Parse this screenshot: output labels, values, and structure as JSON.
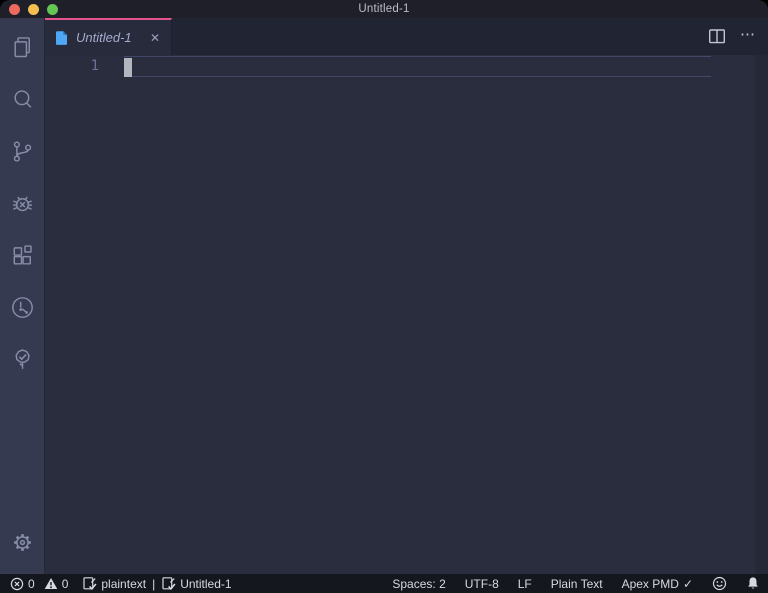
{
  "window": {
    "title": "Untitled-1"
  },
  "traffic_lights": {
    "colors": {
      "close": "#ed6a5e",
      "minimize": "#f5bf4f",
      "zoom": "#62c554"
    }
  },
  "activity_bar": {
    "icons": [
      "files-explorer-icon",
      "search-icon",
      "source-control-icon",
      "bug-debug-icon",
      "extensions-icon",
      "git-graph-icon",
      "todo-tree-icon"
    ],
    "bottom_icons": [
      "settings-gear-icon"
    ]
  },
  "tab": {
    "label": "Untitled-1"
  },
  "icons": {
    "close_tab": "✕",
    "more_actions": "⋯"
  },
  "editor": {
    "line_number": "1"
  },
  "status_bar": {
    "problems": {
      "errors": "0",
      "warnings": "0"
    },
    "editor_info": {
      "language_indicator": "plaintext",
      "separator": "|",
      "file_indicator": "Untitled-1"
    },
    "indentation": "Spaces: 2",
    "encoding": "UTF-8",
    "eol": "LF",
    "language_mode": "Plain Text",
    "extension": "Apex PMD",
    "extension_check": "✓"
  },
  "colors": {
    "accent_tab_border": "#e5548a",
    "file_icon_blue": "#4fa8f5",
    "editor_background": "#292d3e",
    "activity_bar_background": "#353a50",
    "status_bar_background": "#15171f",
    "title_bar_background": "#1e1f28"
  }
}
